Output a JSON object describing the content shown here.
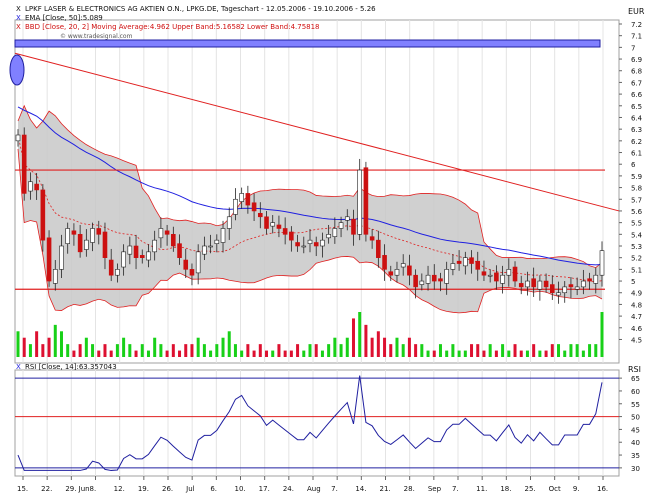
{
  "header": {
    "line1": "LPKF LASER & ELECTRONICS AG AKTIEN O.N., LPKG.DE, Tageschart - 12.05.2006 - 19.10.2006 - 5.26",
    "line2": "EMA [Close, 50]:5.089",
    "line3": "BBD [Close, 20, 2] Moving Average:4.962 Upper Band:5.16582 Lower Band:4.75818",
    "watermark": "© www.tradesignal.com",
    "currency": "EUR"
  },
  "rsi_header": "RSI [Close, 14]:63.357043",
  "rsi_axis_title": "RSI",
  "colors": {
    "ema": "#2020e0",
    "bands": "#e02020",
    "band_fill": "#c8c8c8",
    "up": "#ffffff",
    "down": "#cc1010",
    "vol_up": "#18d018",
    "vol_down": "#dd1030",
    "hline": "#e02020",
    "rsi_line": "#2020a0"
  },
  "chart_data": [
    {
      "type": "candlestick",
      "title": "LPKF LASER & ELECTRONICS AG AKTIEN O.N., LPKG.DE, Tageschart - 12.05.2006 - 19.10.2006 - 5.26",
      "ylabel": "EUR",
      "ylim": [
        4.35,
        7.2
      ],
      "y_ticks": [
        "4.5",
        "4.6",
        "4.7",
        "4.8",
        "4.9",
        "5",
        "5.1",
        "5.2",
        "5.3",
        "5.4",
        "5.5",
        "5.6",
        "5.7",
        "5.8",
        "5.9",
        "6",
        "6.1",
        "6.2",
        "6.3",
        "6.4",
        "6.5",
        "6.6",
        "6.7",
        "6.8",
        "6.9",
        "7",
        "7.1",
        "7.2"
      ],
      "x_tick_labels": [
        "15.",
        "22.",
        "29. Jun",
        "8.",
        "12.",
        "19.",
        "26.",
        "Jul",
        "6.",
        "10.",
        "17.",
        "24.",
        "Aug",
        "7.",
        "14.",
        "21.",
        "28.",
        "Sep",
        "7.",
        "11.",
        "18.",
        "25.",
        "Oct",
        "9.",
        "16."
      ],
      "close": [
        6.25,
        5.75,
        5.85,
        5.78,
        5.35,
        5.0,
        5.1,
        5.3,
        5.45,
        5.4,
        5.25,
        5.35,
        5.45,
        5.4,
        5.2,
        5.05,
        5.1,
        5.25,
        5.3,
        5.2,
        5.2,
        5.25,
        5.35,
        5.45,
        5.4,
        5.3,
        5.2,
        5.1,
        5.05,
        5.25,
        5.3,
        5.3,
        5.35,
        5.45,
        5.55,
        5.7,
        5.75,
        5.65,
        5.6,
        5.55,
        5.45,
        5.5,
        5.45,
        5.4,
        5.35,
        5.3,
        5.3,
        5.35,
        5.3,
        5.35,
        5.4,
        5.45,
        5.5,
        5.55,
        5.4,
        5.95,
        5.4,
        5.35,
        5.2,
        5.1,
        5.05,
        5.1,
        5.15,
        5.05,
        4.95,
        5.0,
        5.05,
        5.0,
        5.0,
        5.1,
        5.15,
        5.15,
        5.2,
        5.15,
        5.1,
        5.05,
        5.05,
        5.0,
        5.05,
        5.1,
        5.0,
        4.95,
        5.0,
        4.95,
        5.0,
        4.95,
        4.9,
        4.9,
        4.95,
        4.95,
        4.95,
        5.0,
        5.0,
        5.05,
        5.26
      ],
      "hlines": [
        5.95,
        4.93
      ],
      "ema": {
        "name": "EMA [Close, 50]",
        "last": 5.089
      },
      "bollinger": {
        "name": "BBD [Close, 20, 2]",
        "ma": 4.962,
        "upper": 5.16582,
        "lower": 4.75818
      },
      "volume": [
        4,
        3,
        2,
        4,
        2,
        3,
        5,
        4,
        2,
        1,
        2,
        3,
        2,
        1,
        2,
        1,
        2,
        3,
        2,
        1,
        2,
        1,
        3,
        2,
        1,
        2,
        1,
        2,
        2,
        3,
        2,
        1,
        2,
        3,
        4,
        2,
        1,
        2,
        1,
        2,
        1,
        1,
        2,
        1,
        1,
        2,
        1,
        2,
        2,
        1,
        2,
        3,
        2,
        3,
        6,
        7,
        5,
        3,
        4,
        3,
        2,
        3,
        2,
        3,
        2,
        2,
        1,
        1,
        2,
        1,
        2,
        1,
        1,
        2,
        2,
        1,
        2,
        1,
        2,
        1,
        2,
        1,
        1,
        2,
        1,
        1,
        2,
        2,
        1,
        2,
        2,
        1,
        2,
        2,
        7
      ]
    },
    {
      "type": "line",
      "title": "RSI [Close, 14]:63.357043",
      "ylabel": "RSI",
      "ylim": [
        28,
        67
      ],
      "y_ticks": [
        "30",
        "35",
        "40",
        "45",
        "50",
        "55",
        "60",
        "65"
      ],
      "hlines": [
        50,
        30
      ],
      "last": 63.357043
    }
  ]
}
